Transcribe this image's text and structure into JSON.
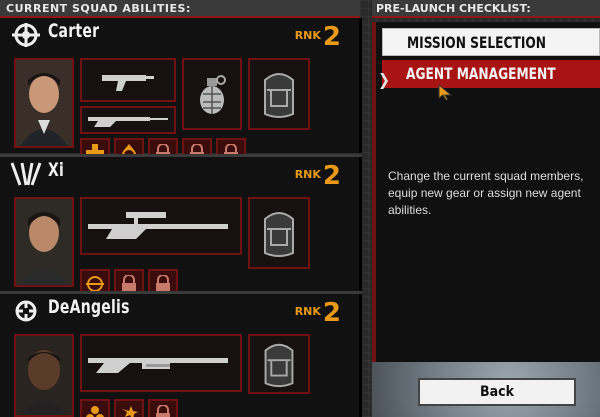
{
  "left_header": "CURRENT SQUAD ABILITIES:",
  "right_header": "PRE-LAUNCH CHECKLIST:",
  "rank_label": "RNK",
  "agents": [
    {
      "name": "Carter",
      "rank": "2",
      "class_icon": "commando-icon",
      "gear": [
        "smg-icon",
        "grenade-icon",
        "rifle-icon",
        "backpack-icon"
      ],
      "abilities": [
        "medic-cross-icon",
        "boost-arrow-icon",
        "lock-icon",
        "lock-icon",
        "lock-icon"
      ]
    },
    {
      "name": "Xi",
      "rank": "2",
      "class_icon": "sniper-icon",
      "gear": [
        "sniper-rifle-icon",
        "backpack-icon"
      ],
      "abilities": [
        "target-icon",
        "lock-icon",
        "lock-icon"
      ]
    },
    {
      "name": "DeAngelis",
      "rank": "2",
      "class_icon": "heavy-icon",
      "gear": [
        "shotgun-icon",
        "backpack-icon"
      ],
      "abilities": [
        "biohazard-icon",
        "shrapnel-icon",
        "lock-icon"
      ]
    }
  ],
  "menu": {
    "mission_selection": "MISSION SELECTION",
    "agent_management": "AGENT MANAGEMENT"
  },
  "description": "Change the current squad members, equip new gear or assign new agent abilities.",
  "back_label": "Back",
  "colors": {
    "accent_red": "#a81414",
    "rank_orange": "#e89a18",
    "frame_red": "#6e1212"
  }
}
